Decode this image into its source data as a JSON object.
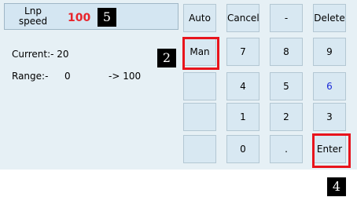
{
  "header": {
    "label": "Lnp\nspeed",
    "value": "100"
  },
  "info": {
    "current": "Current:- 20",
    "range_label": "Range:-",
    "range_min": "0",
    "range_max": "-> 100"
  },
  "badges": {
    "b5": "5",
    "b2": "2",
    "b4": "4"
  },
  "mode_buttons": {
    "auto": "Auto",
    "man": "Man"
  },
  "keypad": {
    "cancel": "Cancel",
    "minus": "-",
    "delete": "Delete",
    "k7": "7",
    "k8": "8",
    "k9": "9",
    "k4": "4",
    "k5": "5",
    "k6": "6",
    "k1": "1",
    "k2": "2",
    "k3": "3",
    "k0": "0",
    "dot": ".",
    "enter": "Enter"
  },
  "colors": {
    "speed_value": "#e8242b",
    "highlight": "#e8141c",
    "key6": "#1b2bd8"
  }
}
